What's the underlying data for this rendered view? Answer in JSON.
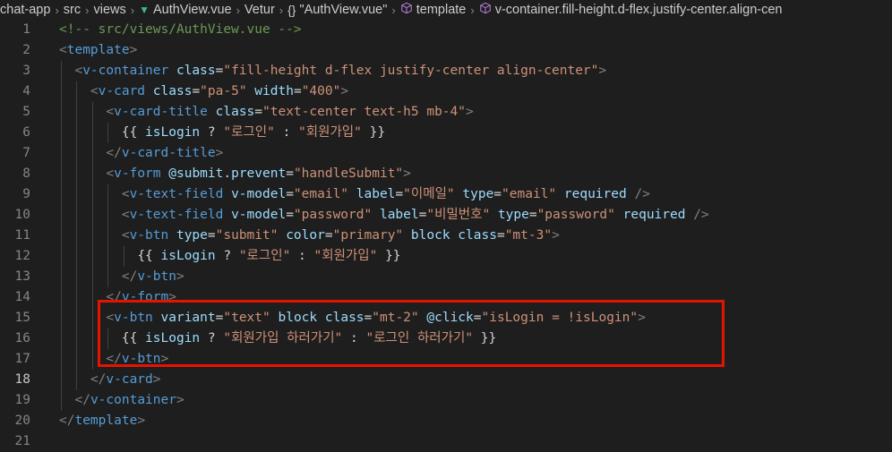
{
  "breadcrumb": {
    "items": [
      "chat-app",
      "src",
      "views",
      "AuthView.vue",
      "Vetur",
      "\"AuthView.vue\"",
      "template",
      "v-container.fill-height.d-flex.justify-center.align-cen"
    ],
    "icons": [
      "",
      "",
      "",
      "vue-icon",
      "",
      "braces-icon",
      "cube-icon",
      "cube-icon"
    ]
  },
  "editor": {
    "active_line": 18,
    "line_numbers": [
      "1",
      "2",
      "3",
      "4",
      "5",
      "6",
      "7",
      "8",
      "9",
      "10",
      "11",
      "12",
      "13",
      "14",
      "15",
      "16",
      "17",
      "18",
      "19",
      "20",
      "21"
    ],
    "lines": [
      [
        [
          "tk-comment",
          "<!-- src/views/AuthView.vue -->"
        ]
      ],
      [
        [
          "tk-punct",
          "<"
        ],
        [
          "tk-tag",
          "template"
        ],
        [
          "tk-punct",
          ">"
        ]
      ],
      [
        [
          "tk-plain",
          "  "
        ],
        [
          "tk-punct",
          "<"
        ],
        [
          "tk-tag",
          "v-container"
        ],
        [
          "tk-plain",
          " "
        ],
        [
          "tk-attr",
          "class"
        ],
        [
          "tk-plain",
          "="
        ],
        [
          "tk-str",
          "\"fill-height d-flex justify-center align-center\""
        ],
        [
          "tk-punct",
          ">"
        ]
      ],
      [
        [
          "tk-plain",
          "    "
        ],
        [
          "tk-punct",
          "<"
        ],
        [
          "tk-tag",
          "v-card"
        ],
        [
          "tk-plain",
          " "
        ],
        [
          "tk-attr",
          "class"
        ],
        [
          "tk-plain",
          "="
        ],
        [
          "tk-str",
          "\"pa-5\""
        ],
        [
          "tk-plain",
          " "
        ],
        [
          "tk-attr",
          "width"
        ],
        [
          "tk-plain",
          "="
        ],
        [
          "tk-str",
          "\"400\""
        ],
        [
          "tk-punct",
          ">"
        ]
      ],
      [
        [
          "tk-plain",
          "      "
        ],
        [
          "tk-punct",
          "<"
        ],
        [
          "tk-tag",
          "v-card-title"
        ],
        [
          "tk-plain",
          " "
        ],
        [
          "tk-attr",
          "class"
        ],
        [
          "tk-plain",
          "="
        ],
        [
          "tk-str",
          "\"text-center text-h5 mb-4\""
        ],
        [
          "tk-punct",
          ">"
        ]
      ],
      [
        [
          "tk-plain",
          "        "
        ],
        [
          "tk-brace",
          "{{ "
        ],
        [
          "tk-var",
          "isLogin"
        ],
        [
          "tk-op",
          " ? "
        ],
        [
          "tk-str",
          "\"로그인\""
        ],
        [
          "tk-op",
          " : "
        ],
        [
          "tk-str",
          "\"회원가입\""
        ],
        [
          "tk-brace",
          " }}"
        ]
      ],
      [
        [
          "tk-plain",
          "      "
        ],
        [
          "tk-punct",
          "</"
        ],
        [
          "tk-tag",
          "v-card-title"
        ],
        [
          "tk-punct",
          ">"
        ]
      ],
      [
        [
          "tk-plain",
          "      "
        ],
        [
          "tk-punct",
          "<"
        ],
        [
          "tk-tag",
          "v-form"
        ],
        [
          "tk-plain",
          " "
        ],
        [
          "tk-attr",
          "@submit"
        ],
        [
          "tk-plain",
          "."
        ],
        [
          "tk-attr",
          "prevent"
        ],
        [
          "tk-plain",
          "="
        ],
        [
          "tk-str",
          "\"handleSubmit\""
        ],
        [
          "tk-punct",
          ">"
        ]
      ],
      [
        [
          "tk-plain",
          "        "
        ],
        [
          "tk-punct",
          "<"
        ],
        [
          "tk-tag",
          "v-text-field"
        ],
        [
          "tk-plain",
          " "
        ],
        [
          "tk-attr",
          "v-model"
        ],
        [
          "tk-plain",
          "="
        ],
        [
          "tk-str",
          "\"email\""
        ],
        [
          "tk-plain",
          " "
        ],
        [
          "tk-attr",
          "label"
        ],
        [
          "tk-plain",
          "="
        ],
        [
          "tk-str",
          "\"이메일\""
        ],
        [
          "tk-plain",
          " "
        ],
        [
          "tk-attr",
          "type"
        ],
        [
          "tk-plain",
          "="
        ],
        [
          "tk-str",
          "\"email\""
        ],
        [
          "tk-plain",
          " "
        ],
        [
          "tk-attr",
          "required"
        ],
        [
          "tk-plain",
          " "
        ],
        [
          "tk-punct",
          "/>"
        ]
      ],
      [
        [
          "tk-plain",
          "        "
        ],
        [
          "tk-punct",
          "<"
        ],
        [
          "tk-tag",
          "v-text-field"
        ],
        [
          "tk-plain",
          " "
        ],
        [
          "tk-attr",
          "v-model"
        ],
        [
          "tk-plain",
          "="
        ],
        [
          "tk-str",
          "\"password\""
        ],
        [
          "tk-plain",
          " "
        ],
        [
          "tk-attr",
          "label"
        ],
        [
          "tk-plain",
          "="
        ],
        [
          "tk-str",
          "\"비밀번호\""
        ],
        [
          "tk-plain",
          " "
        ],
        [
          "tk-attr",
          "type"
        ],
        [
          "tk-plain",
          "="
        ],
        [
          "tk-str",
          "\"password\""
        ],
        [
          "tk-plain",
          " "
        ],
        [
          "tk-attr",
          "required"
        ],
        [
          "tk-plain",
          " "
        ],
        [
          "tk-punct",
          "/>"
        ]
      ],
      [
        [
          "tk-plain",
          "        "
        ],
        [
          "tk-punct",
          "<"
        ],
        [
          "tk-tag",
          "v-btn"
        ],
        [
          "tk-plain",
          " "
        ],
        [
          "tk-attr",
          "type"
        ],
        [
          "tk-plain",
          "="
        ],
        [
          "tk-str",
          "\"submit\""
        ],
        [
          "tk-plain",
          " "
        ],
        [
          "tk-attr",
          "color"
        ],
        [
          "tk-plain",
          "="
        ],
        [
          "tk-str",
          "\"primary\""
        ],
        [
          "tk-plain",
          " "
        ],
        [
          "tk-attr",
          "block"
        ],
        [
          "tk-plain",
          " "
        ],
        [
          "tk-attr",
          "class"
        ],
        [
          "tk-plain",
          "="
        ],
        [
          "tk-str",
          "\"mt-3\""
        ],
        [
          "tk-punct",
          ">"
        ]
      ],
      [
        [
          "tk-plain",
          "          "
        ],
        [
          "tk-brace",
          "{{ "
        ],
        [
          "tk-var",
          "isLogin"
        ],
        [
          "tk-op",
          " ? "
        ],
        [
          "tk-str",
          "\"로그인\""
        ],
        [
          "tk-op",
          " : "
        ],
        [
          "tk-str",
          "\"회원가입\""
        ],
        [
          "tk-brace",
          " }}"
        ]
      ],
      [
        [
          "tk-plain",
          "        "
        ],
        [
          "tk-punct",
          "</"
        ],
        [
          "tk-tag",
          "v-btn"
        ],
        [
          "tk-punct",
          ">"
        ]
      ],
      [
        [
          "tk-plain",
          "      "
        ],
        [
          "tk-punct",
          "</"
        ],
        [
          "tk-tag",
          "v-form"
        ],
        [
          "tk-punct",
          ">"
        ]
      ],
      [
        [
          "tk-plain",
          "      "
        ],
        [
          "tk-punct",
          "<"
        ],
        [
          "tk-tag",
          "v-btn"
        ],
        [
          "tk-plain",
          " "
        ],
        [
          "tk-attr",
          "variant"
        ],
        [
          "tk-plain",
          "="
        ],
        [
          "tk-str",
          "\"text\""
        ],
        [
          "tk-plain",
          " "
        ],
        [
          "tk-attr",
          "block"
        ],
        [
          "tk-plain",
          " "
        ],
        [
          "tk-attr",
          "class"
        ],
        [
          "tk-plain",
          "="
        ],
        [
          "tk-str",
          "\"mt-2\""
        ],
        [
          "tk-plain",
          " "
        ],
        [
          "tk-attr",
          "@click"
        ],
        [
          "tk-plain",
          "="
        ],
        [
          "tk-str",
          "\"isLogin = !isLogin\""
        ],
        [
          "tk-punct",
          ">"
        ]
      ],
      [
        [
          "tk-plain",
          "        "
        ],
        [
          "tk-brace",
          "{{ "
        ],
        [
          "tk-var",
          "isLogin"
        ],
        [
          "tk-op",
          " ? "
        ],
        [
          "tk-str",
          "\"회원가입 하러가기\""
        ],
        [
          "tk-op",
          " : "
        ],
        [
          "tk-str",
          "\"로그인 하러가기\""
        ],
        [
          "tk-brace",
          " }}"
        ]
      ],
      [
        [
          "tk-plain",
          "      "
        ],
        [
          "tk-punct",
          "</"
        ],
        [
          "tk-tag",
          "v-btn"
        ],
        [
          "tk-punct",
          ">"
        ]
      ],
      [
        [
          "tk-plain",
          "    "
        ],
        [
          "tk-punct",
          "</"
        ],
        [
          "tk-tag",
          "v-card"
        ],
        [
          "tk-punct",
          ">"
        ]
      ],
      [
        [
          "tk-plain",
          "  "
        ],
        [
          "tk-punct",
          "</"
        ],
        [
          "tk-tag",
          "v-container"
        ],
        [
          "tk-punct",
          ">"
        ]
      ],
      [
        [
          "tk-punct",
          "</"
        ],
        [
          "tk-tag",
          "template"
        ],
        [
          "tk-punct",
          ">"
        ]
      ],
      []
    ]
  },
  "colors": {
    "background": "#1e1e1e",
    "highlight_border": "#e51400"
  }
}
